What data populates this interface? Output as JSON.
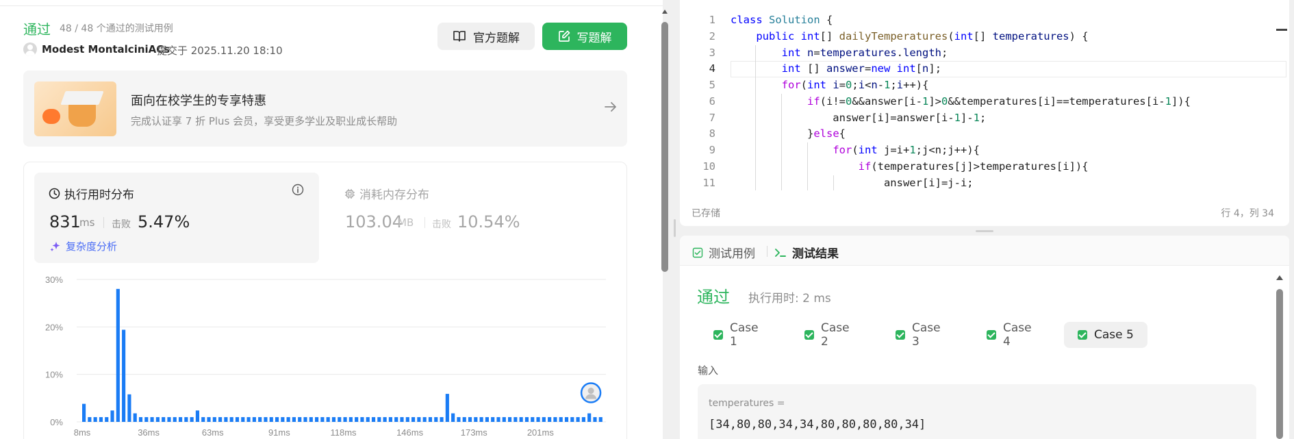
{
  "submission": {
    "status": "通过",
    "case_summary": "48 / 48 个通过的测试用例",
    "author": "Modest MontalciniACs",
    "submitted_at": "提交于 2025.11.20 18:10",
    "official_solution_label": "官方题解",
    "write_solution_label": "写题解"
  },
  "promo": {
    "title": "面向在校学生的专享特惠",
    "subtitle": "完成认证享 7 折 Plus 会员，享受更多学业及职业成长帮助"
  },
  "runtime": {
    "title": "执行用时分布",
    "value": "831",
    "unit": "ms",
    "beat_label": "击败",
    "beat_value": "5.47%",
    "complexity_link": "复杂度分析"
  },
  "memory": {
    "title": "消耗内存分布",
    "value": "103.04",
    "unit": "MB",
    "beat_label": "击败",
    "beat_value": "10.54%"
  },
  "chart_data": {
    "type": "bar",
    "title": "",
    "xlabel": "",
    "ylabel": "",
    "ylim": [
      0,
      30
    ],
    "y_ticks": [
      "0%",
      "10%",
      "20%",
      "30%"
    ],
    "x_ticks": [
      "8ms",
      "36ms",
      "63ms",
      "91ms",
      "118ms",
      "146ms",
      "173ms",
      "201ms"
    ],
    "x_range": [
      8,
      228
    ],
    "bar_color": "#1a7cf5",
    "bin_width_ms": 3.5,
    "values": [
      3.8,
      1.0,
      1.0,
      1.0,
      1.0,
      2.4,
      28.0,
      19.4,
      5.8,
      1.8,
      1.0,
      1.0,
      1.0,
      1.0,
      1.0,
      1.0,
      1.0,
      1.0,
      1.0,
      1.0,
      2.4,
      1.0,
      1.0,
      1.0,
      1.0,
      1.0,
      1.0,
      1.0,
      1.0,
      1.0,
      1.0,
      1.0,
      1.0,
      1.0,
      1.0,
      1.0,
      1.0,
      1.0,
      1.0,
      1.0,
      1.0,
      1.0,
      1.0,
      1.0,
      1.0,
      1.0,
      1.0,
      1.0,
      1.0,
      1.0,
      1.0,
      1.0,
      1.0,
      1.0,
      1.0,
      1.0,
      1.0,
      1.0,
      1.0,
      1.0,
      1.0,
      1.0,
      1.0,
      1.0,
      5.9,
      1.8,
      1.0,
      1.0,
      1.0,
      1.0,
      1.0,
      1.0,
      1.0,
      1.0,
      1.0,
      1.0,
      1.0,
      1.0,
      1.0,
      1.0,
      1.0,
      1.0,
      1.0,
      1.0,
      1.0,
      1.0,
      1.0,
      1.0,
      1.0,
      1.8,
      1.0,
      1.0
    ],
    "grid": true,
    "marker": "user-avatar"
  },
  "editor": {
    "lines": [
      {
        "n": "1",
        "html": "<span class=\"kw\">class</span> <span class=\"cls\">Solution</span> {"
      },
      {
        "n": "2",
        "html": "    <span class=\"kw\">public</span> <span class=\"kw\">int</span>[] <span class=\"fn\">dailyTemperatures</span>(<span class=\"kw\">int</span>[] <span class=\"pm\">temperatures</span>) {"
      },
      {
        "n": "3",
        "html": "        <span class=\"kw\">int</span> <span class=\"pm\">n</span>=<span class=\"pm\">temperatures</span>.<span class=\"pm\">length</span>;"
      },
      {
        "n": "4",
        "html": "        <span class=\"kw\">int</span> [] <span class=\"pm\">answer</span>=<span class=\"kw\">new</span> <span class=\"kw\">int</span>[<span class=\"pm\">n</span>];"
      },
      {
        "n": "5",
        "html": "        <span class=\"ct\">for</span>(<span class=\"kw\">int</span> <span class=\"pm\">i</span>=<span class=\"nm\">0</span>;<span class=\"pm\">i</span>&lt;<span class=\"pm\">n</span>-<span class=\"nm\">1</span>;<span class=\"pm\">i</span>++){"
      },
      {
        "n": "6",
        "html": "            <span class=\"ct\">if</span>(i!=<span class=\"nm\">0</span>&amp;&amp;answer[i-<span class=\"nm\">1</span>]&gt;<span class=\"nm\">0</span>&amp;&amp;temperatures[i]==temperatures[i-<span class=\"nm\">1</span>]){"
      },
      {
        "n": "7",
        "html": "                answer[i]=answer[i-<span class=\"nm\">1</span>]-<span class=\"nm\">1</span>;"
      },
      {
        "n": "8",
        "html": "            }<span class=\"ct\">else</span>{"
      },
      {
        "n": "9",
        "html": "                <span class=\"ct\">for</span>(<span class=\"kw\">int</span> j=i+<span class=\"nm\">1</span>;j&lt;n;j++){"
      },
      {
        "n": "10",
        "html": "                    <span class=\"ct\">if</span>(temperatures[j]&gt;temperatures[i]){"
      },
      {
        "n": "11",
        "html": "                        answer[i]=j-i;"
      }
    ],
    "saved_label": "已存储",
    "cursor_position": "行 4，列 34"
  },
  "results": {
    "tab_cases": "测试用例",
    "tab_result": "测试结果",
    "status": "通过",
    "runtime": "执行用时: 2 ms",
    "cases": [
      "Case 1",
      "Case 2",
      "Case 3",
      "Case 4",
      "Case 5"
    ],
    "active_case": 4,
    "input_label": "输入",
    "var_name": "temperatures =",
    "var_value": "[34,80,80,34,34,80,80,80,80,34]"
  }
}
